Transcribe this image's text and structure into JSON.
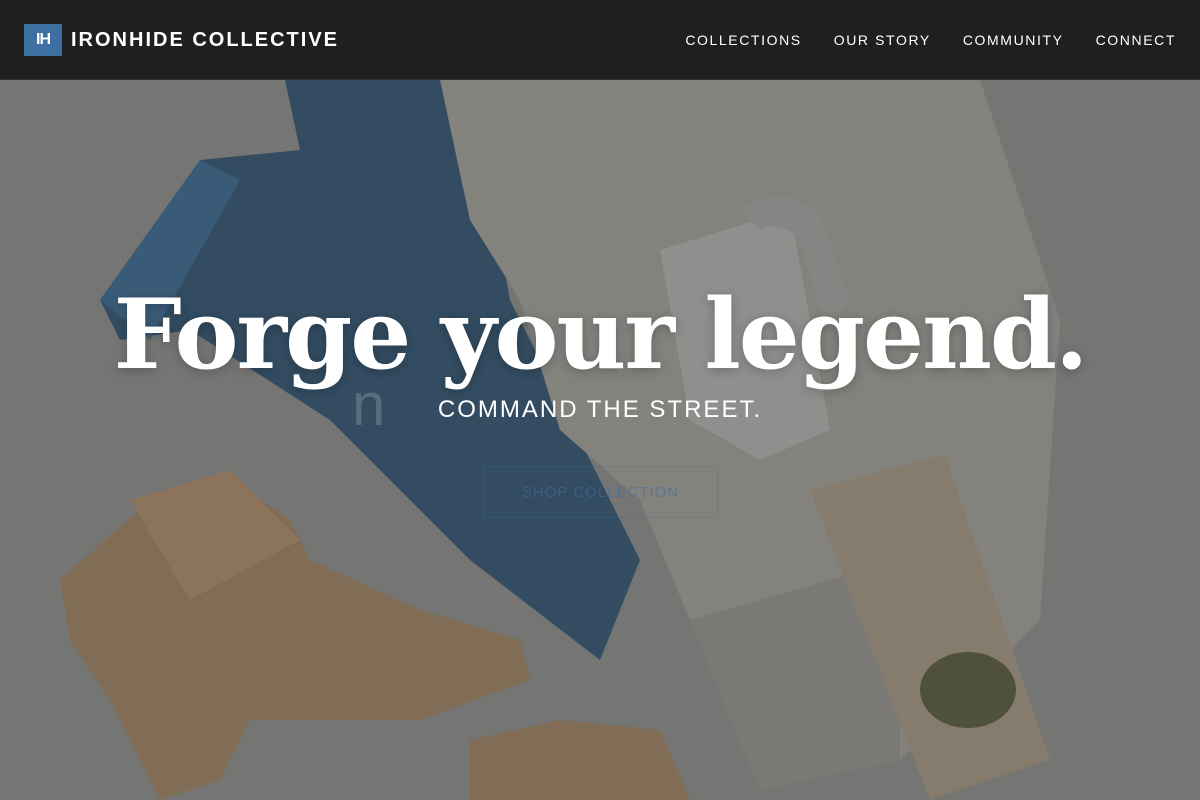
{
  "header": {
    "logo_badge": "IH",
    "brand_name": "IRONHIDE COLLECTIVE",
    "nav": [
      {
        "label": "COLLECTIONS"
      },
      {
        "label": "OUR STORY"
      },
      {
        "label": "COMMUNITY"
      },
      {
        "label": "CONNECT"
      }
    ]
  },
  "hero": {
    "headline": "Forge your legend.",
    "subline": "COMMAND THE STREET.",
    "ghost_text": "n",
    "cta_label": "SHOP COLLECTION"
  },
  "colors": {
    "accent": "#3d6fa3",
    "header_bg": "#181818",
    "text": "#ffffff"
  }
}
